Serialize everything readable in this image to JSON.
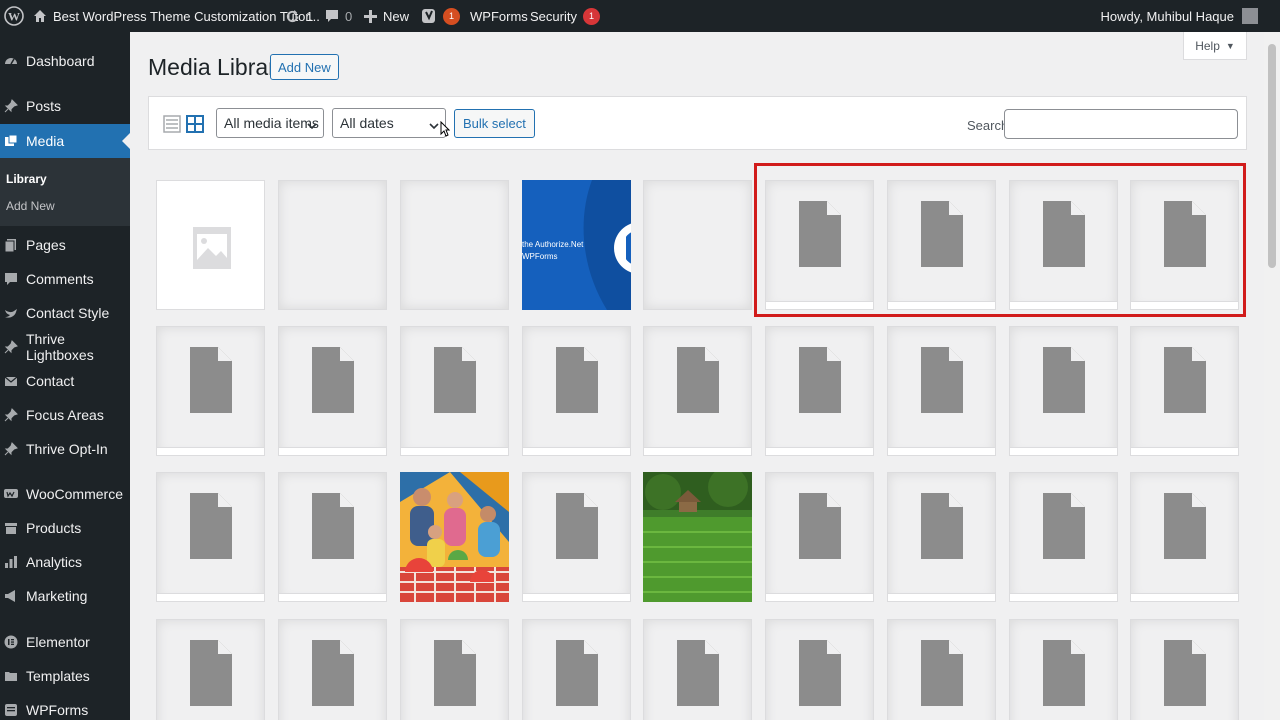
{
  "admin_bar": {
    "site_name": "Best WordPress Theme Customization Tutor...",
    "updates_count": "1",
    "comments_count": "0",
    "new_label": "New",
    "yoast_badge": "1",
    "wpforms_label": "WPForms",
    "security_label": "Security",
    "security_badge": "1",
    "greeting": "Howdy, Muhibul Haque"
  },
  "sidebar": {
    "items": [
      {
        "label": "Dashboard",
        "icon": "dashboard-icon"
      },
      {
        "label": "Posts",
        "icon": "pin-icon"
      },
      {
        "label": "Media",
        "icon": "media-icon"
      },
      {
        "label": "Pages",
        "icon": "pages-icon"
      },
      {
        "label": "Comments",
        "icon": "comment-icon"
      },
      {
        "label": "Contact Style",
        "icon": "bird-icon"
      },
      {
        "label": "Thrive Lightboxes",
        "icon": "pin-icon"
      },
      {
        "label": "Contact",
        "icon": "mail-icon"
      },
      {
        "label": "Focus Areas",
        "icon": "pin-icon"
      },
      {
        "label": "Thrive Opt-In",
        "icon": "pin-icon"
      },
      {
        "label": "WooCommerce",
        "icon": "woo-icon"
      },
      {
        "label": "Products",
        "icon": "archive-icon"
      },
      {
        "label": "Analytics",
        "icon": "bar-chart-icon"
      },
      {
        "label": "Marketing",
        "icon": "megaphone-icon"
      },
      {
        "label": "Elementor",
        "icon": "elementor-icon"
      },
      {
        "label": "Templates",
        "icon": "folder-icon"
      },
      {
        "label": "WPForms",
        "icon": "wpforms-icon"
      }
    ],
    "submenu": [
      "Library",
      "Add New"
    ]
  },
  "help_label": "Help",
  "page": {
    "title": "Media Library",
    "add_new_label": "Add New"
  },
  "toolbar": {
    "type_filter": "All media items",
    "date_filter": "All dates",
    "bulk_select_label": "Bulk select",
    "search_label": "Search",
    "search_value": ""
  },
  "blue_tile_text": [
    "the Authorize.Net",
    "WPForms"
  ],
  "colors": {
    "admin_dark": "#1d2327",
    "accent": "#2271b1",
    "badge": "#d63638",
    "highlight": "#d11b1b"
  }
}
